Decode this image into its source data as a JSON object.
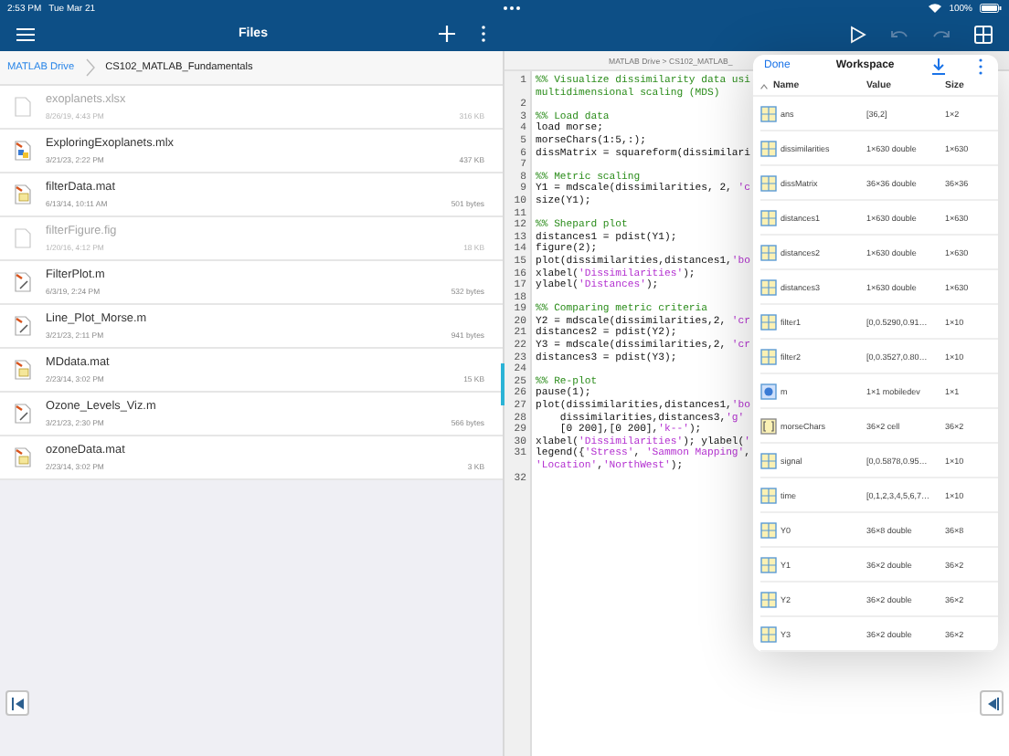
{
  "status_bar": {
    "time": "2:53 PM",
    "date": "Tue Mar 21",
    "battery": "100%"
  },
  "files_toolbar": {
    "title": "Files"
  },
  "editor_toolbar": [
    {
      "kind": "run",
      "disabled": false
    },
    {
      "kind": "undo",
      "disabled": true
    },
    {
      "kind": "redo",
      "disabled": true
    },
    {
      "kind": "workspace",
      "disabled": false
    }
  ],
  "breadcrumb": {
    "parent": "MATLAB Drive",
    "current": "CS102_MATLAB_Fundamentals"
  },
  "files": [
    {
      "name": "exoplanets.xlsx",
      "date": "8/26/19, 4:43 PM",
      "size": "316 KB",
      "kind": "generic",
      "disabled": true
    },
    {
      "name": "ExploringExoplanets.mlx",
      "date": "3/21/23, 2:22 PM",
      "size": "437 KB",
      "kind": "live",
      "disabled": false
    },
    {
      "name": "filterData.mat",
      "date": "6/13/14, 10:11 AM",
      "size": "501 bytes",
      "kind": "mat",
      "disabled": false
    },
    {
      "name": "filterFigure.fig",
      "date": "1/20/16, 4:12 PM",
      "size": "18 KB",
      "kind": "generic",
      "disabled": true
    },
    {
      "name": "FilterPlot.m",
      "date": "6/3/19, 2:24 PM",
      "size": "532 bytes",
      "kind": "script",
      "disabled": false
    },
    {
      "name": "Line_Plot_Morse.m",
      "date": "3/21/23, 2:11 PM",
      "size": "941 bytes",
      "kind": "script",
      "disabled": false
    },
    {
      "name": "MDdata.mat",
      "date": "2/23/14, 3:02 PM",
      "size": "15 KB",
      "kind": "mat",
      "disabled": false
    },
    {
      "name": "Ozone_Levels_Viz.m",
      "date": "3/21/23, 2:30 PM",
      "size": "566 bytes",
      "kind": "script",
      "disabled": false
    },
    {
      "name": "ozoneData.mat",
      "date": "2/23/14, 3:02 PM",
      "size": "3 KB",
      "kind": "mat",
      "disabled": false
    }
  ],
  "editor": {
    "path": "MATLAB Drive > CS102_MATLAB_",
    "lines": [
      {
        "number": "1",
        "text": "%% Visualize dissimilarity data usi",
        "kind": "comment"
      },
      {
        "text": "multidimensional scaling (MDS)",
        "kind": "comment"
      },
      {
        "number": "2"
      },
      {
        "number": "3",
        "text": "%% Load data",
        "kind": "comment"
      },
      {
        "number": "4",
        "text": "load morse;",
        "kind": "code"
      },
      {
        "number": "5",
        "text": "morseChars(1:5,:);",
        "kind": "code"
      },
      {
        "number": "6",
        "text": "dissMatrix = squareform(dissimilari",
        "kind": "code"
      },
      {
        "number": "7"
      },
      {
        "number": "8",
        "text": "%% Metric scaling",
        "kind": "comment"
      },
      {
        "number": "9",
        "text": "Y1 = mdscale(dissimilarities, 2, 'c",
        "kind": "code"
      },
      {
        "number": "10",
        "text": "size(Y1);",
        "kind": "code"
      },
      {
        "number": "11"
      },
      {
        "number": "12",
        "text": "%% Shepard plot",
        "kind": "comment"
      },
      {
        "number": "13",
        "text": "distances1 = pdist(Y1);",
        "kind": "code"
      },
      {
        "number": "14",
        "text": "figure(2);",
        "kind": "code"
      },
      {
        "number": "15",
        "text": "plot(dissimilarities,distances1,'bo",
        "kind": "code"
      },
      {
        "number": "16",
        "text": "xlabel('Dissimilarities');",
        "kind": "code"
      },
      {
        "number": "17",
        "text": "ylabel('Distances');",
        "kind": "code"
      },
      {
        "number": "18"
      },
      {
        "number": "19",
        "text": "%% Comparing metric criteria",
        "kind": "comment"
      },
      {
        "number": "20",
        "text": "Y2 = mdscale(dissimilarities,2, 'cr",
        "kind": "code"
      },
      {
        "number": "21",
        "text": "distances2 = pdist(Y2);",
        "kind": "code"
      },
      {
        "number": "22",
        "text": "Y3 = mdscale(dissimilarities,2, 'cr",
        "kind": "code"
      },
      {
        "number": "23",
        "text": "distances3 = pdist(Y3);",
        "kind": "code"
      },
      {
        "number": "24"
      },
      {
        "number": "25",
        "text": "%% Re-plot",
        "kind": "comment"
      },
      {
        "number": "26",
        "text": "pause(1);",
        "kind": "code"
      },
      {
        "number": "27",
        "text": "plot(dissimilarities,distances1,'bo",
        "kind": "code"
      },
      {
        "number": "28",
        "text": "    dissimilarities,distances3,'g'",
        "kind": "code"
      },
      {
        "number": "29",
        "text": "    [0 200],[0 200],'k--');",
        "kind": "code"
      },
      {
        "number": "30",
        "text": "xlabel('Dissimilarities'); ylabel('",
        "kind": "code"
      },
      {
        "number": "31",
        "text": "legend({'Stress', 'Sammon Mapping',",
        "kind": "code"
      },
      {
        "text": "'Location','NorthWest');",
        "kind": "code"
      },
      {
        "number": "32"
      }
    ]
  },
  "workspace": {
    "done": "Done",
    "title": "Workspace",
    "columns": [
      "Name",
      "Value",
      "Size"
    ],
    "variables": [
      {
        "name": "ans",
        "value": "[36,2]",
        "size": "1×2",
        "kind": "matrix"
      },
      {
        "name": "dissimilarities",
        "value": "1×630 double",
        "size": "1×630",
        "kind": "matrix"
      },
      {
        "name": "dissMatrix",
        "value": "36×36 double",
        "size": "36×36",
        "kind": "matrix"
      },
      {
        "name": "distances1",
        "value": "1×630 double",
        "size": "1×630",
        "kind": "matrix"
      },
      {
        "name": "distances2",
        "value": "1×630 double",
        "size": "1×630",
        "kind": "matrix"
      },
      {
        "name": "distances3",
        "value": "1×630 double",
        "size": "1×630",
        "kind": "matrix"
      },
      {
        "name": "filter1",
        "value": "[0,0.5290,0.91…",
        "size": "1×10",
        "kind": "matrix"
      },
      {
        "name": "filter2",
        "value": "[0,0.3527,0.80…",
        "size": "1×10",
        "kind": "matrix"
      },
      {
        "name": "m",
        "value": "1×1 mobiledev",
        "size": "1×1",
        "kind": "object"
      },
      {
        "name": "morseChars",
        "value": "36×2 cell",
        "size": "36×2",
        "kind": "cell"
      },
      {
        "name": "signal",
        "value": "[0,0.5878,0.95…",
        "size": "1×10",
        "kind": "matrix"
      },
      {
        "name": "time",
        "value": "[0,1,2,3,4,5,6,7…",
        "size": "1×10",
        "kind": "matrix"
      },
      {
        "name": "Y0",
        "value": "36×8 double",
        "size": "36×8",
        "kind": "matrix"
      },
      {
        "name": "Y1",
        "value": "36×2 double",
        "size": "36×2",
        "kind": "matrix"
      },
      {
        "name": "Y2",
        "value": "36×2 double",
        "size": "36×2",
        "kind": "matrix"
      },
      {
        "name": "Y3",
        "value": "36×2 double",
        "size": "36×2",
        "kind": "matrix"
      }
    ]
  }
}
